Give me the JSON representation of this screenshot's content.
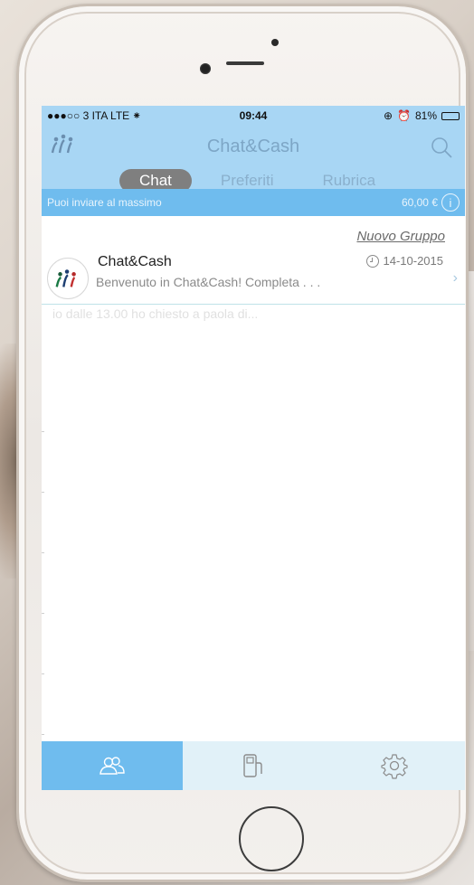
{
  "status_bar": {
    "carrier": "●●●○○ 3 ITA  LTE",
    "loading_glyph": "⁕",
    "time": "09:44",
    "lock_glyph": "⊕",
    "alarm_glyph": "⏰",
    "battery_percent": "81%",
    "battery_level": 0.81
  },
  "navbar": {
    "title": "Chat&Cash",
    "search_icon": "search-icon",
    "logo_icon": "chat-cash-logo"
  },
  "tabs": [
    {
      "label": "Chat",
      "active": true
    },
    {
      "label": "Preferiti",
      "active": false
    },
    {
      "label": "Rubrica",
      "active": false
    }
  ],
  "info_bar": {
    "label": "Puoi inviare al massimo",
    "amount": "60,00 €",
    "info_glyph": "i"
  },
  "list": {
    "new_group_link": "Nuovo Gruppo",
    "chats": [
      {
        "name": "Chat&Cash",
        "date": "14-10-2015",
        "preview": "Benvenuto in Chat&Cash! Completa . . .",
        "chevron": "›"
      }
    ],
    "ghost_text": "io dalle 13.00 ho chiesto a paola di..."
  },
  "tabbar": [
    {
      "icon": "contacts-icon",
      "active": true
    },
    {
      "icon": "fuel-pump-icon",
      "active": false
    },
    {
      "icon": "gear-icon",
      "active": false
    }
  ],
  "colors": {
    "header_bg": "#a8d6f4",
    "info_bg": "#6fbcee",
    "tab_active_bg": "#7f7f7f",
    "tabbar_active_bg": "#6fbcee",
    "tabbar_inactive_bg": "#e1f1f8"
  }
}
